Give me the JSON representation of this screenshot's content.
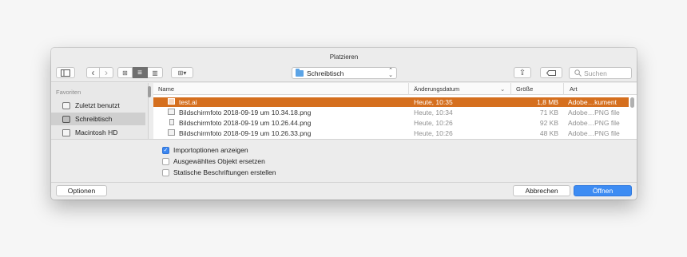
{
  "window": {
    "title": "Platzieren"
  },
  "toolbar": {
    "sidebar_icon": "sidebar-toggle-icon",
    "back_icon": "‹",
    "forward_icon": "›",
    "view_icons": "⊞",
    "view_list": "≡",
    "view_columns": "▥",
    "arrange_icon": "⊞▾",
    "location": "Schreibtisch",
    "location_chevron": "⌃⌄",
    "share_icon": "⇪",
    "tag_icon": "⬭",
    "search_icon": "🔍",
    "search_placeholder": "Suchen"
  },
  "sidebar": {
    "section": "Favoriten",
    "items": [
      {
        "label": "Zuletzt benutzt",
        "icon": "recents-icon",
        "selected": false
      },
      {
        "label": "Schreibtisch",
        "icon": "desktop-icon",
        "selected": true
      },
      {
        "label": "Macintosh HD",
        "icon": "harddisk-icon",
        "selected": false
      }
    ]
  },
  "filelist": {
    "columns": {
      "name": "Name",
      "date": "Änderungsdatum",
      "size": "Größe",
      "kind": "Art",
      "sort_indicator": "⌄"
    },
    "rows": [
      {
        "name": "test.ai",
        "date": "Heute, 10:35",
        "size": "1,8 MB",
        "kind": "Adobe…kument",
        "selected": true
      },
      {
        "name": "Bildschirmfoto 2018-09-19 um 10.34.18.png",
        "date": "Heute, 10:34",
        "size": "71 KB",
        "kind": "Adobe…PNG file",
        "selected": false
      },
      {
        "name": "Bildschirmfoto 2018-09-19 um 10.26.44.png",
        "date": "Heute, 10:26",
        "size": "92 KB",
        "kind": "Adobe…PNG file",
        "selected": false
      },
      {
        "name": "Bildschirmfoto 2018-09-19 um 10.26.33.png",
        "date": "Heute, 10:26",
        "size": "48 KB",
        "kind": "Adobe…PNG file",
        "selected": false
      }
    ]
  },
  "options": {
    "items": [
      {
        "label": "Importoptionen anzeigen",
        "checked": true
      },
      {
        "label": "Ausgewähltes Objekt ersetzen",
        "checked": false
      },
      {
        "label": "Statische Beschriftungen erstellen",
        "checked": false
      }
    ],
    "check_mark": "✓"
  },
  "buttons": {
    "options": "Optionen",
    "cancel": "Abbrechen",
    "open": "Öffnen"
  },
  "colors": {
    "selection": "#d56f1e",
    "accent": "#3d8cf3"
  }
}
